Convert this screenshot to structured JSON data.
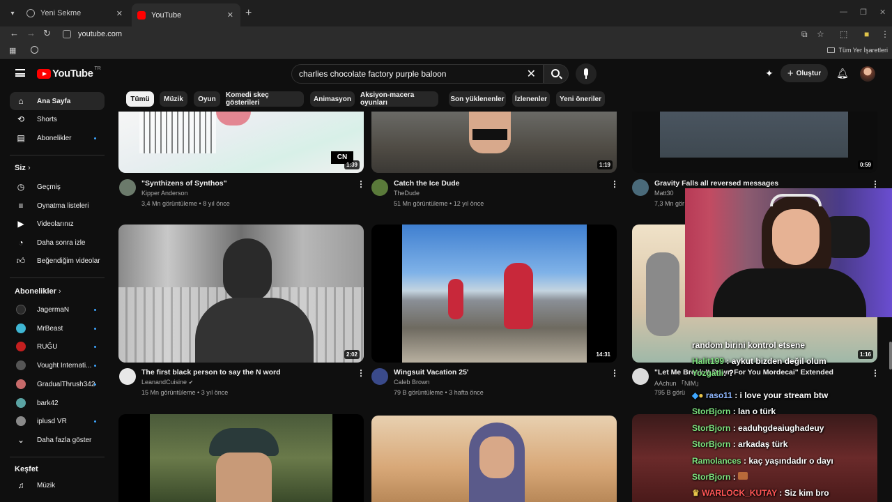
{
  "browser": {
    "tabs": [
      {
        "label": "Yeni Sekme",
        "active": false
      },
      {
        "label": "YouTube",
        "active": true
      }
    ],
    "url": "youtube.com",
    "bookmarks_right": "Tüm Yer İşaretleri"
  },
  "header": {
    "logo_text": "YouTube",
    "logo_country": "TR",
    "search_value": "charlies chocolate factory purple baloon",
    "create_label": "Oluştur"
  },
  "sidebar": {
    "main": [
      {
        "label": "Ana Sayfa",
        "icon": "home-icon",
        "active": true
      },
      {
        "label": "Shorts",
        "icon": "shorts-icon"
      },
      {
        "label": "Abonelikler",
        "icon": "subscriptions-icon",
        "dot": true
      }
    ],
    "you_heading": "Siz",
    "you": [
      {
        "label": "Geçmiş",
        "icon": "history-icon"
      },
      {
        "label": "Oynatma listeleri",
        "icon": "playlists-icon"
      },
      {
        "label": "Videolarınız",
        "icon": "your-videos-icon"
      },
      {
        "label": "Daha sonra izle",
        "icon": "watch-later-icon"
      },
      {
        "label": "Beğendiğim videolar",
        "icon": "liked-icon"
      }
    ],
    "subs_heading": "Abonelikler",
    "subs": [
      {
        "label": "JagermaN",
        "color": "#2a2a2a",
        "dot": true
      },
      {
        "label": "MrBeast",
        "color": "#3fb6d3",
        "dot": true
      },
      {
        "label": "RUĞU",
        "color": "#c41f1f",
        "dot": true
      },
      {
        "label": "Vought Internati...",
        "color": "#555555",
        "dot": true
      },
      {
        "label": "GradualThrush342",
        "color": "#c76a6a",
        "dot": true
      },
      {
        "label": "bark42",
        "color": "#5aa3a3"
      },
      {
        "label": "iplusd VR",
        "color": "#8a8a8a",
        "dot": true
      }
    ],
    "show_more": "Daha fazla göster",
    "explore_heading": "Keşfet",
    "explore": [
      {
        "label": "Müzik",
        "icon": "music-icon"
      }
    ]
  },
  "chips": [
    "Tümü",
    "Müzik",
    "Oyun",
    "Komedi skeç gösterileri",
    "Animasyon",
    "Aksiyon-macera oyunları",
    "Son yüklenenler",
    "İzlenenler",
    "Yeni öneriler"
  ],
  "videos_row1": [
    {
      "title": "\"Synthizens of Synthos\"",
      "channel": "Kipper Anderson",
      "stats": "3,4 Mn görüntüleme • 8 yıl önce",
      "duration": "1:39",
      "badge": "CN"
    },
    {
      "title": "Catch the Ice Dude",
      "channel": "TheDude",
      "stats": "51 Mn görüntüleme • 12 yıl önce",
      "duration": "1:19"
    },
    {
      "title": "Gravity Falls all reversed messages",
      "channel": "Matt30",
      "stats": "7,3 Mn gör",
      "duration": "0:59"
    }
  ],
  "videos_row2": [
    {
      "title": "The first black person to say the N word",
      "channel": "LeanandCuisine",
      "stats": "15 Mn görüntüleme • 3 yıl önce",
      "duration": "2:02"
    },
    {
      "title": "Wingsuit Vacation 25'",
      "channel": "Caleb Brown",
      "stats": "79 B görüntüleme • 3 hafta önce",
      "duration": "14:31"
    },
    {
      "title": "\"Let Me Break It Down For You Mordecai\" Extended",
      "channel": "AAchun 「NIM」",
      "stats": "795 B görü",
      "duration": "1:16"
    }
  ],
  "chat": [
    {
      "user": "",
      "text": "random birini kontrol etsene"
    },
    {
      "user": "Halit199",
      "text": ": aykut bizden değil olum",
      "color": "green"
    },
    {
      "user": "Yozgatli",
      "text": ": ?",
      "color": "green"
    },
    {
      "user": "raso11",
      "text": ": i love your stream btw",
      "color": "blue"
    },
    {
      "user": "StorBjorn",
      "text": ": lan o türk",
      "color": "green"
    },
    {
      "user": "StorBjorn",
      "text": ": eaduhgdeaiughadeuy",
      "color": "green"
    },
    {
      "user": "StorBjorn",
      "text": ": arkadaş türk",
      "color": "green"
    },
    {
      "user": "Ramolances",
      "text": ": kaç yaşındadır o dayı",
      "color": "green"
    },
    {
      "user": "StorBjorn",
      "text": ":",
      "color": "green"
    },
    {
      "user": "WARLOCK_KUTAY",
      "text": ": Siz kim bro",
      "color": "red"
    }
  ]
}
